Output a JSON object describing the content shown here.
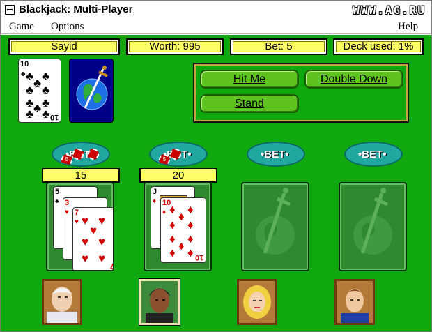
{
  "window": {
    "title": "Blackjack: Multi-Player",
    "watermark": "WWW.AG.RU"
  },
  "menu": {
    "game": "Game",
    "options": "Options",
    "help": "Help"
  },
  "info": {
    "player": "Sayid",
    "worth": "Worth: 995",
    "bet": "Bet: 5",
    "deck_used": "Deck used: 1%"
  },
  "deck": {
    "top_card_rank": "10",
    "top_card_suit": "clubs"
  },
  "buttons": {
    "hit": "Hit Me",
    "double": "Double Down",
    "stand": "Stand"
  },
  "seats": [
    {
      "bet_label": "BET",
      "chip_value": "5",
      "score": "15",
      "cards": [
        "5 of spades",
        "3 of hearts",
        "7 of hearts"
      ]
    },
    {
      "bet_label": "BET",
      "chip_value": "5",
      "score": "20",
      "cards": [
        "J of diamonds",
        "10 of diamonds"
      ]
    },
    {
      "bet_label": "BET"
    },
    {
      "bet_label": "BET"
    }
  ],
  "colors": {
    "felt": "#0fa80f",
    "info_bg": "#ffff66",
    "button": "#5ec21f",
    "bet_oval": "#20a8a0",
    "chip": "#cc0000"
  },
  "icons": {
    "deck_back": "globe-sword-emblem",
    "empty_slot": "globe-sword-emblem"
  }
}
